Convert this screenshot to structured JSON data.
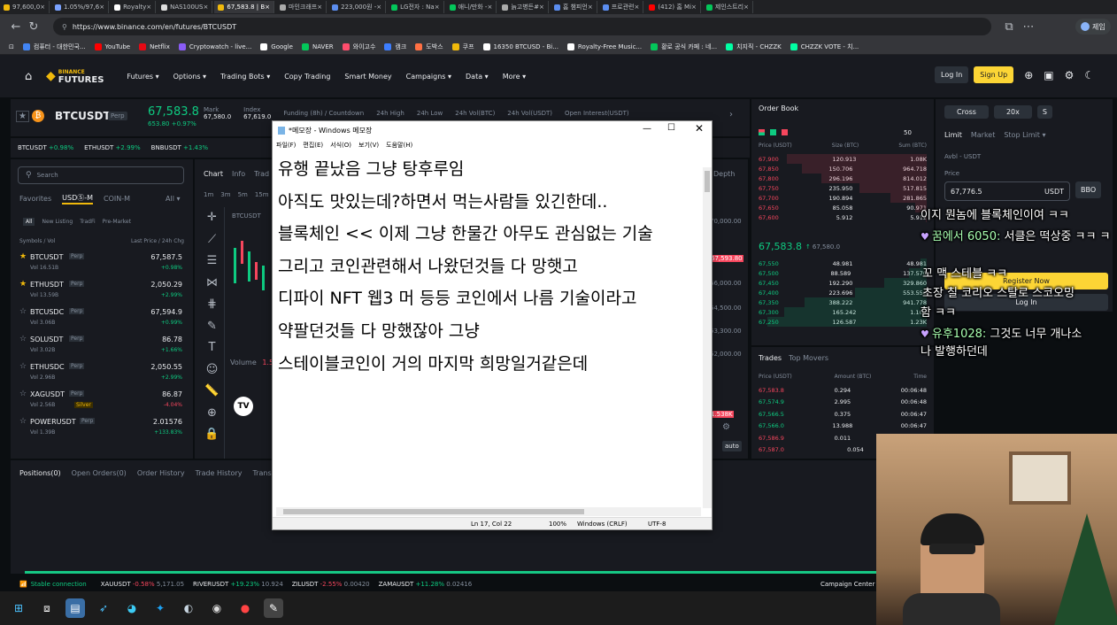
{
  "browser": {
    "tabs": [
      {
        "label": "97,600,0",
        "color": "#f0b90b"
      },
      {
        "label": "1.05%/97,6",
        "color": "#7aa2ff"
      },
      {
        "label": "Royalty",
        "color": "#ffffff"
      },
      {
        "label": "NAS100US",
        "color": "#dddddd"
      },
      {
        "label": "67,583.8 | B",
        "color": "#f0b90b"
      },
      {
        "label": "마인크래프",
        "color": "#aaaaaa"
      },
      {
        "label": "223,000원 -",
        "color": "#5b8def"
      },
      {
        "label": "LG전자 : Na",
        "color": "#03c75a"
      },
      {
        "label": "애니/만화 -",
        "color": "#03c75a"
      },
      {
        "label": "늙고병든#",
        "color": "#aaaaaa"
      },
      {
        "label": "홈 챔피언",
        "color": "#5b8def"
      },
      {
        "label": "프로관련",
        "color": "#5b8def"
      },
      {
        "label": "(412) 홈 Mi",
        "color": "#ff0000"
      },
      {
        "label": "제인스트리",
        "color": "#03c75a"
      }
    ],
    "url": "https://www.binance.com/en/futures/BTCUSDT",
    "profile": "제임",
    "bookmarks": [
      {
        "label": "컴퓨터 - 대한민국...",
        "color": "#4285f4"
      },
      {
        "label": "YouTube",
        "color": "#ff0000"
      },
      {
        "label": "Netflix",
        "color": "#e50914"
      },
      {
        "label": "Cryptowatch - live...",
        "color": "#8a5cf6"
      },
      {
        "label": "Google",
        "color": "#ffffff"
      },
      {
        "label": "NAVER",
        "color": "#03c75a"
      },
      {
        "label": "와이고수",
        "color": "#ff4d6d"
      },
      {
        "label": "캠크",
        "color": "#3d7eff"
      },
      {
        "label": "도박스",
        "color": "#ff7043"
      },
      {
        "label": "쿠프",
        "color": "#f0b90b"
      },
      {
        "label": "16350 BTCUSD - Bi...",
        "color": "#ffffff"
      },
      {
        "label": "Royalty-Free Music...",
        "color": "#ffffff"
      },
      {
        "label": "황로 공식 카페 : 네...",
        "color": "#03c75a"
      },
      {
        "label": "치지직 - CHZZK",
        "color": "#00ffa3"
      },
      {
        "label": "CHZZK VOTE - 치...",
        "color": "#00ffa3"
      }
    ]
  },
  "binance": {
    "logo_top": "BINANCE",
    "logo_bottom": "FUTURES",
    "nav": [
      "Futures",
      "Options",
      "Trading Bots",
      "Copy Trading",
      "Smart Money",
      "Campaigns",
      "Data",
      "More"
    ],
    "login": "Log In",
    "signup": "Sign Up",
    "symbol": "BTCUSDT",
    "perp": "Perp",
    "price": "67,583.8",
    "price_usd": "653.80 +0.97%",
    "stats": [
      {
        "label": "Mark",
        "value": "67,580.0"
      },
      {
        "label": "Index",
        "value": "67,619.0"
      },
      {
        "label": "Funding (8h) / Countdown",
        "value": ""
      },
      {
        "label": "24h High",
        "value": ""
      },
      {
        "label": "24h Low",
        "value": ""
      },
      {
        "label": "24h Vol(BTC)",
        "value": ""
      },
      {
        "label": "24h Vol(USDT)",
        "value": ""
      },
      {
        "label": "Open Interest(USDT)",
        "value": ""
      }
    ],
    "ticker_strip": [
      {
        "sym": "BTCUSDT",
        "chg": "+0.98%"
      },
      {
        "sym": "ETHUSDT",
        "chg": "+2.99%"
      },
      {
        "sym": "BNBUSDT",
        "chg": "+1.43%"
      }
    ],
    "search_placeholder": "Search",
    "market_tabs": [
      "Favorites",
      "USDⓈ-M",
      "COIN-M",
      "All"
    ],
    "filter_tabs": [
      "All",
      "New Listing",
      "TradFi",
      "Pre-Market"
    ],
    "list_header": {
      "sym": "Symbols / Vol",
      "price": "Last Price / 24h Chg"
    },
    "markets": [
      {
        "sym": "BTCUSDT",
        "tag": "Perp",
        "vol": "Vol 16.51B",
        "price": "67,587.5",
        "chg": "+0.98%",
        "fav": true
      },
      {
        "sym": "ETHUSDT",
        "tag": "Perp",
        "vol": "Vol 13.59B",
        "price": "2,050.29",
        "chg": "+2.99%",
        "fav": true
      },
      {
        "sym": "BTCUSDC",
        "tag": "Perp",
        "vol": "Vol 3.06B",
        "price": "67,594.9",
        "chg": "+0.99%",
        "fav": false
      },
      {
        "sym": "SOLUSDT",
        "tag": "Perp",
        "vol": "Vol 3.02B",
        "price": "86.78",
        "chg": "+1.66%",
        "fav": false
      },
      {
        "sym": "ETHUSDC",
        "tag": "Perp",
        "vol": "Vol 2.96B",
        "price": "2,050.55",
        "chg": "+2.99%",
        "fav": false
      },
      {
        "sym": "XAGUSDT",
        "tag": "Perp",
        "vol": "Vol 2.56B",
        "price": "86.87",
        "chg": "-4.04%",
        "fav": false,
        "extra": "Silver"
      },
      {
        "sym": "POWERUSDT",
        "tag": "Perp",
        "vol": "Vol 1.39B",
        "price": "2.01576",
        "chg": "+133.83%",
        "fav": false
      }
    ],
    "chart_tabs": [
      "Chart",
      "Info",
      "Trad"
    ],
    "timeframes": [
      "1m",
      "3m",
      "5m",
      "15m"
    ],
    "chart_symbol": "BTCUSDT",
    "volume_label": "Volume",
    "volume_value": "1.5",
    "axis_labels": [
      "70,000.00",
      "67,593.80",
      "66,000.00",
      "64,500.00",
      "63,300.00",
      "62,000.00",
      "1.538K"
    ],
    "depth_label": "Depth",
    "auto_label": "auto",
    "orderbook": {
      "title": "Order Book",
      "step": "50",
      "headers": [
        "Price (USDT)",
        "Size (BTC)",
        "Sum (BTC)"
      ],
      "asks": [
        [
          "67,900",
          "120.913",
          "1.08K"
        ],
        [
          "67,850",
          "150.706",
          "964.718"
        ],
        [
          "67,800",
          "296.196",
          "814.012"
        ],
        [
          "67,750",
          "235.950",
          "517.815"
        ],
        [
          "67,700",
          "190.894",
          "281.865"
        ],
        [
          "67,650",
          "85.058",
          "90.971"
        ],
        [
          "67,600",
          "5.912",
          "5.912"
        ]
      ],
      "mid": "67,583.8",
      "mid_sub": "67,580.0",
      "bids": [
        [
          "67,550",
          "48.981",
          "48.981"
        ],
        [
          "67,500",
          "88.589",
          "137.570"
        ],
        [
          "67,450",
          "192.290",
          "329.860"
        ],
        [
          "67,400",
          "223.696",
          "553.556"
        ],
        [
          "67,350",
          "388.222",
          "941.778"
        ],
        [
          "67,300",
          "165.242",
          "1.10K"
        ],
        [
          "67,250",
          "126.587",
          "1.23K"
        ]
      ]
    },
    "trades": {
      "tabs": [
        "Trades",
        "Top Movers"
      ],
      "headers": [
        "Price (USDT)",
        "Amount (BTC)",
        "Time"
      ],
      "rows": [
        [
          "67,583.8",
          "0.294",
          "00:06:48",
          "red"
        ],
        [
          "67,574.9",
          "2.995",
          "00:06:48",
          "green"
        ],
        [
          "67,566.5",
          "0.375",
          "00:06:47",
          "green"
        ],
        [
          "67,566.0",
          "13.988",
          "00:06:47",
          "green"
        ],
        [
          "67,586.9",
          "0.011",
          "00:06:47",
          "red"
        ],
        [
          "67,587.0",
          "0.054",
          "",
          "red"
        ]
      ]
    },
    "order_form": {
      "margin": "Cross",
      "leverage": "20x",
      "mode": "S",
      "types": [
        "Limit",
        "Market",
        "Stop Limit"
      ],
      "avbl": "Avbl - USDT",
      "price_label": "Price",
      "price_value": "67,776.5",
      "price_unit": "USDT",
      "bbo": "BBO",
      "register": "Register Now",
      "login": "Log In"
    },
    "bottom_tabs": [
      "Positions(0)",
      "Open Orders(0)",
      "Order History",
      "Trade History",
      "Trans"
    ],
    "status": {
      "conn": "Stable connection",
      "tickers": [
        {
          "sym": "XAUUSDT",
          "chg": "-0.58%",
          "price": "5,171.05",
          "dir": "red"
        },
        {
          "sym": "RIVERUSDT",
          "chg": "+19.23%",
          "price": "10.924",
          "dir": "green"
        },
        {
          "sym": "ZILUSDT",
          "chg": "-2.55%",
          "price": "0.00420",
          "dir": "red"
        },
        {
          "sym": "ZAMAUSDT",
          "chg": "+11.28%",
          "price": "0.02416",
          "dir": "green"
        }
      ],
      "campaign": "Campaign Center"
    }
  },
  "notepad": {
    "title": "*메모장 - Windows 메모장",
    "menu": [
      "파일(F)",
      "편집(E)",
      "서식(O)",
      "보기(V)",
      "도움말(H)"
    ],
    "lines": [
      "유행 끝났음 그냥 탕후루임",
      "아직도 맛있는데?하면서 먹는사람들 있긴한데..",
      "블록체인 << 이제 그냥 한물간 아무도 관심없는 기술",
      "그리고 코인관련해서 나왔던것들 다 망햇고",
      "디파이 NFT 웹3 머 등등 코인에서 나름 기술이라고",
      "약팔던것들 다 망했잖아 그냥",
      "스테이블코인이 거의 마지막 희망일거같은데"
    ],
    "status": {
      "pos": "Ln 17, Col 22",
      "zoom": "100%",
      "eol": "Windows (CRLF)",
      "enc": "UTF-8"
    }
  },
  "chat": [
    {
      "user": "",
      "text": "이지 뭔놈에 블록체인이여 ㅋㅋ"
    },
    {
      "user": "꿈에서 6050",
      "text": "서클은 떡상중 ㅋㅋ ㅋ"
    },
    {
      "user": "",
      "text": "꼬 맥 스테블 ㅋㅋ"
    },
    {
      "user": "",
      "text": "초장 칠 코리오 스탈로 스코오밍"
    },
    {
      "user": "",
      "text": "함 ㅋㅋ"
    },
    {
      "user": "유후1028",
      "text": "그것도 너무 개나소"
    },
    {
      "user": "",
      "text": "나 발행하던데"
    }
  ],
  "colors": {
    "green": "#0ecb81",
    "red": "#f6465d",
    "yellow": "#f0b90b",
    "chat_user": "#a8ffb0"
  }
}
